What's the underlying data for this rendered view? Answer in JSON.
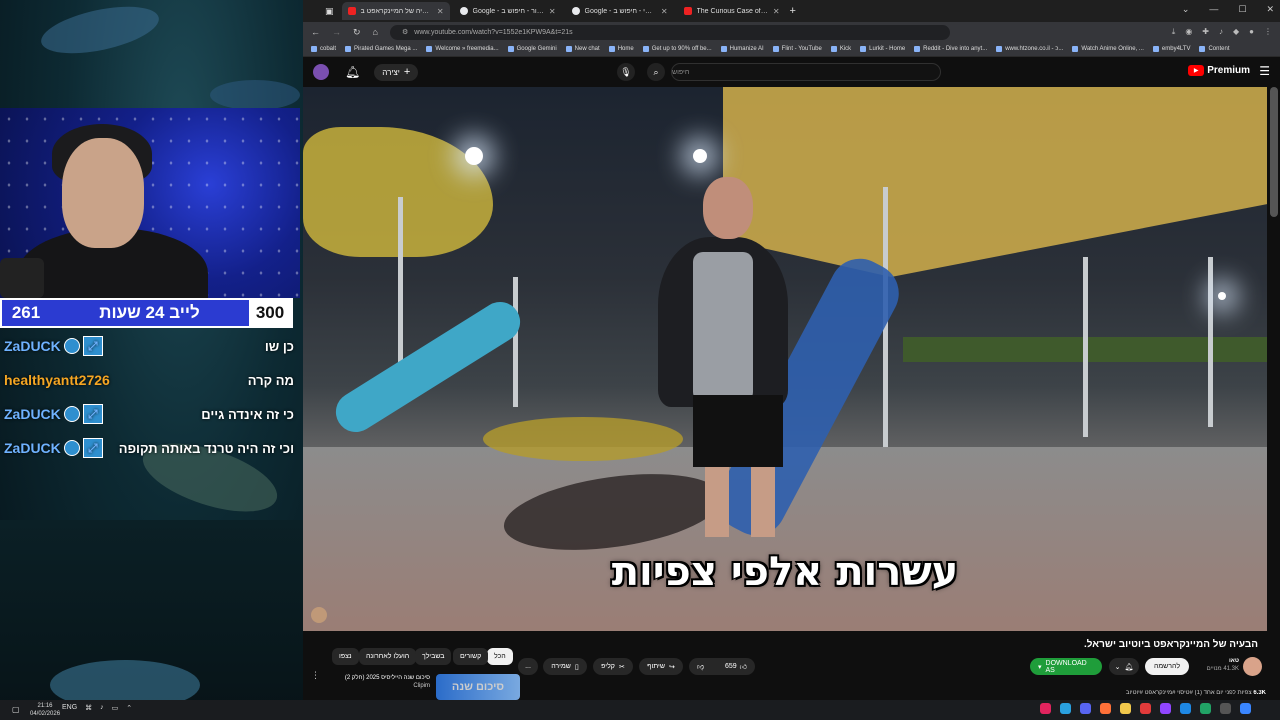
{
  "stream": {
    "live_bar": {
      "left_count": "261",
      "title": "לייב 24 שעות",
      "right_count": "300"
    },
    "chat": [
      {
        "user": "ZaDUCK",
        "color": "#6fb2ff",
        "message": "כן שו",
        "badges": true
      },
      {
        "user": "healthyantt2726",
        "color": "#f5a623",
        "message": "מה קרה",
        "badges": false
      },
      {
        "user": "ZaDUCK",
        "color": "#6fb2ff",
        "message": "כי זה אינדה גיים",
        "badges": true
      },
      {
        "user": "ZaDUCK",
        "color": "#6fb2ff",
        "message": "וכי זה היה טרנד באותה תקופה",
        "badges": true
      }
    ]
  },
  "browser": {
    "tabs": [
      {
        "title": "הבעיה של המיינקראפט ב",
        "active": true,
        "icon": "youtube-icon"
      },
      {
        "title": "Google - סרטור - חיפוש ב",
        "active": false,
        "icon": "google-icon"
      },
      {
        "title": "Google - קלוסי - חיפוש ב",
        "active": false,
        "icon": "google-icon"
      },
      {
        "title": "The Curious Case of Clavicular",
        "active": false,
        "icon": "youtube-icon"
      }
    ],
    "new_tab": "+",
    "url": "www.youtube.com/watch?v=1552e1KPW9A&t=21s",
    "bookmarks": [
      "cobalt",
      "Pirated Games Mega ...",
      "Welcome » freemedia...",
      "Google Gemini",
      "New chat",
      "Home",
      "Get up to 90% off be...",
      "Humanize AI",
      "Flint - YouTube",
      "Kick",
      "Lurkit - Home",
      "Reddit - Dive into anyt...",
      "www.htzone.co.il - כ...",
      "Watch Anime Online, ...",
      "emby4LTV",
      "Content"
    ]
  },
  "youtube": {
    "create_label": "יצירה",
    "search_placeholder": "חיפוש",
    "logo": "Premium",
    "caption": "עשרות אלפי צפיות",
    "video_title": "הבעיה של המיינקראפט ביוטיוב ישראל.",
    "channel": {
      "name": "טאו",
      "subs": "41.3K מנויים"
    },
    "subscribe_label": "להרשמה",
    "download_label": "DOWNLOAD AS",
    "likes": "659",
    "share_label": "שיתוף",
    "clip_label": "קליפ",
    "save_label": "שמירה",
    "more_label": "...",
    "chips": [
      "הכל",
      "קשורים",
      "בשבילך",
      "הועלו לאחרונה",
      "נצפו"
    ],
    "rec": {
      "title": "סיכום שנה הייליסיס 2025 (חלק 2)",
      "channel": "Clipim",
      "thumb_text": "סיכום שנה"
    },
    "description": {
      "views": "6.3K",
      "text": "צפיות לפני יום אחד (1) #טיסוי #מיינקראפט #יוטיוב"
    }
  },
  "taskbar": {
    "time": "21:16",
    "date": "04/02/2026",
    "lang": "ENG"
  },
  "colors": {
    "accent_red": "#ff0000",
    "download_green": "#1f9d3a",
    "live_blue": "#2b3bd1"
  }
}
